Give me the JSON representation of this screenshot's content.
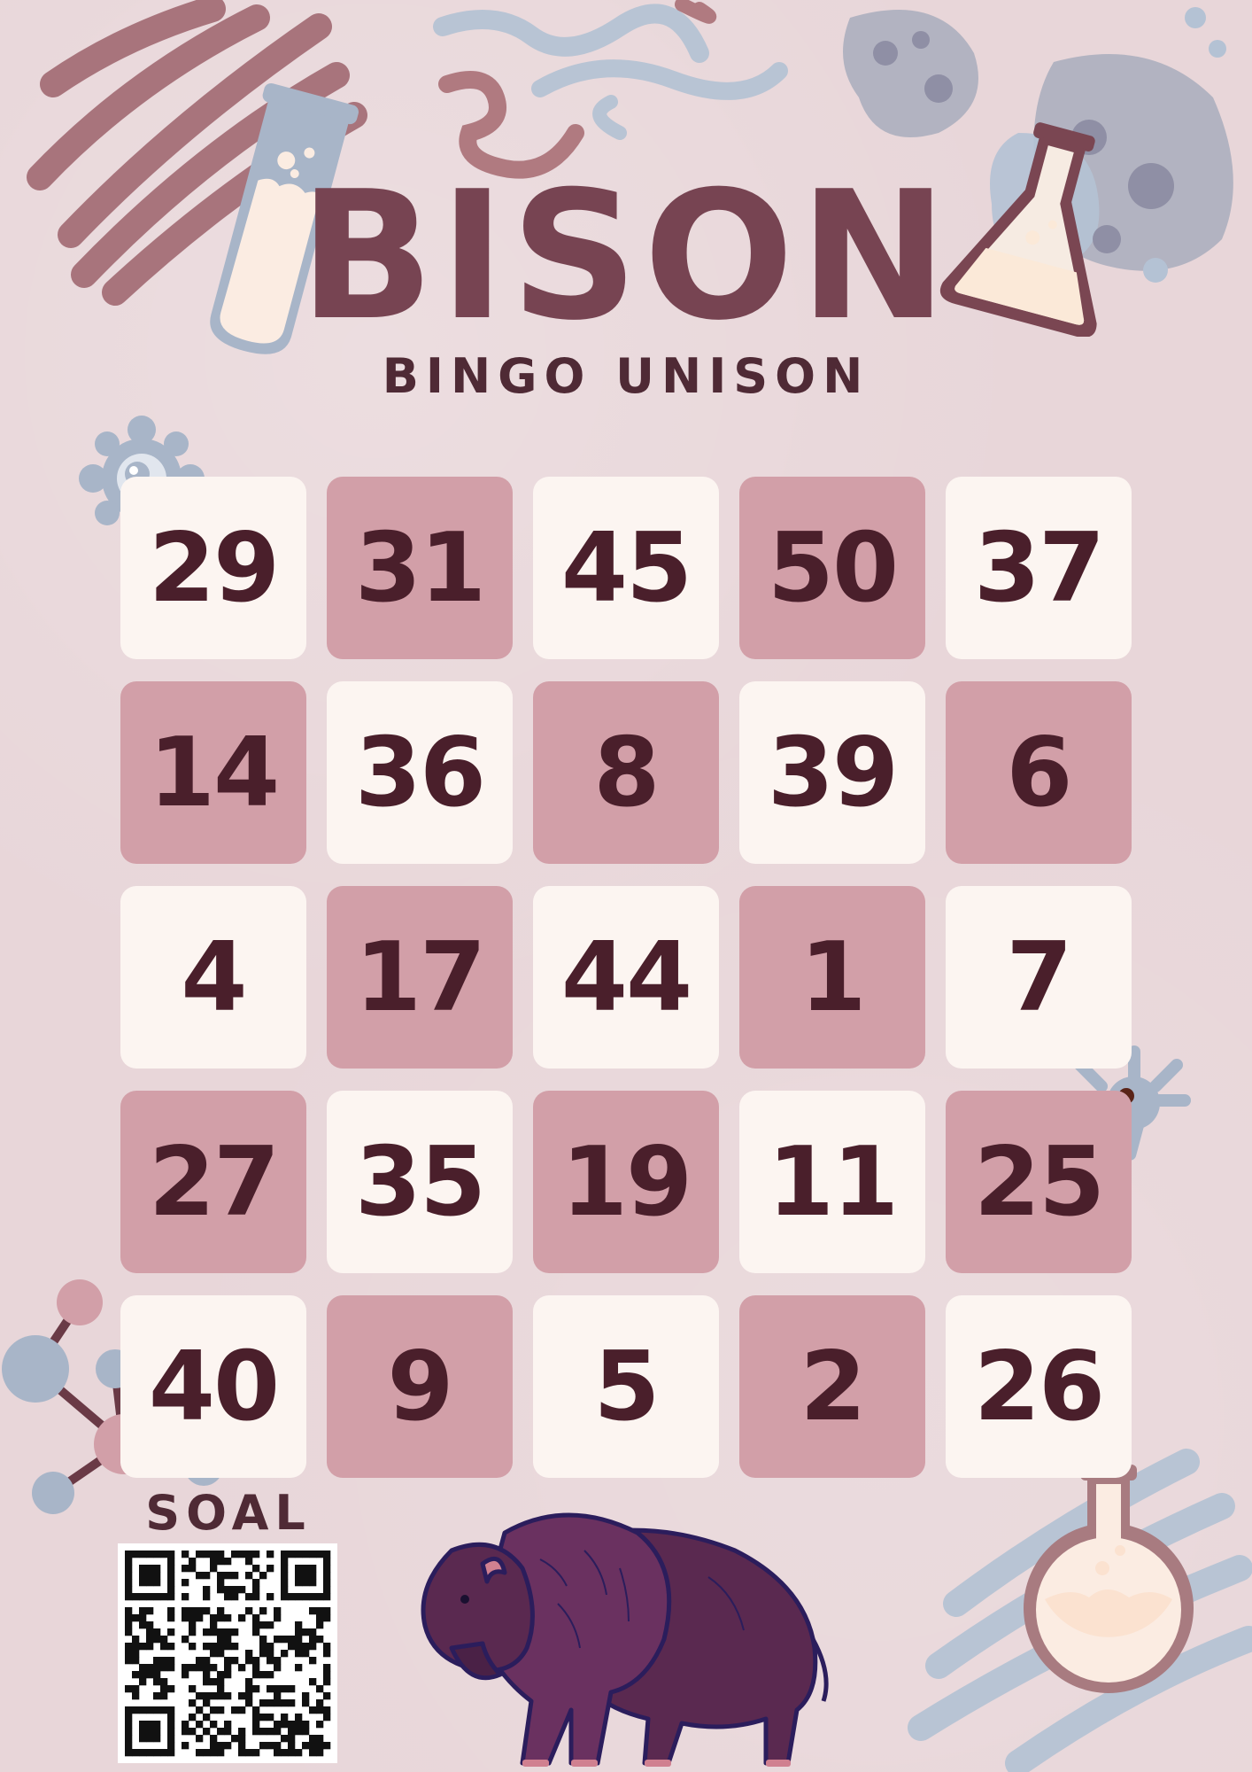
{
  "poster": {
    "title": "BISON",
    "subtitle": "BINGO UNISON",
    "qr_label": "SOAL"
  },
  "board": {
    "rows": [
      [
        "29",
        "31",
        "45",
        "50",
        "37"
      ],
      [
        "14",
        "36",
        "8",
        "39",
        "6"
      ],
      [
        "4",
        "17",
        "44",
        "1",
        "7"
      ],
      [
        "27",
        "35",
        "19",
        "11",
        "25"
      ],
      [
        "40",
        "9",
        "5",
        "2",
        "26"
      ]
    ]
  },
  "colors": {
    "background": "#e8d6d9",
    "cell_light": "#fcf5f1",
    "cell_dark": "#d29fa8",
    "number_text": "#4a1f2b",
    "title": "#774452",
    "accent_blue": "#a8b5c8"
  },
  "icons": [
    "test-tube-icon",
    "erlenmeyer-flask-icon",
    "round-flask-icon",
    "gear-bacteria-icon",
    "splat-bacteria-icon",
    "molecule-icon",
    "bison-illustration",
    "qr-code-icon"
  ]
}
